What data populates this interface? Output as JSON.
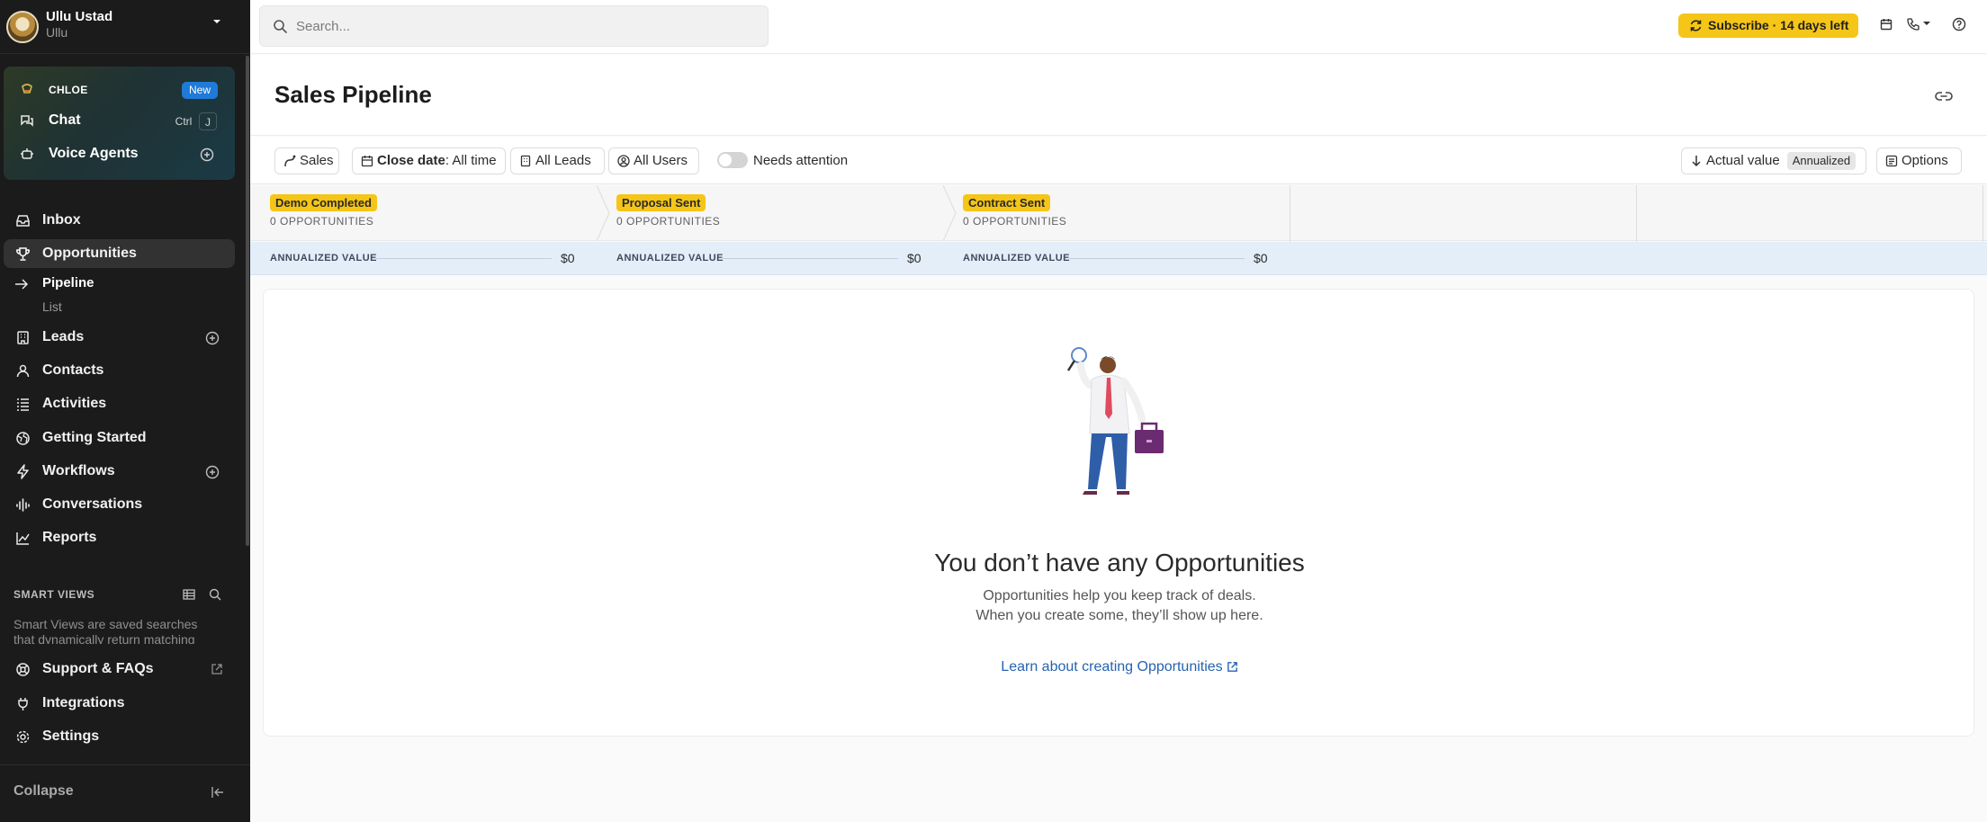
{
  "account": {
    "name": "Ullu Ustad",
    "org": "Ullu"
  },
  "ai": {
    "chloe_label": "CHLOE",
    "chloe_badge": "New",
    "chat_label": "Chat",
    "chat_kbd_ctrl": "Ctrl",
    "chat_kbd_key": "J",
    "voice_label": "Voice Agents"
  },
  "nav": {
    "inbox": "Inbox",
    "opportunities": "Opportunities",
    "pipeline": "Pipeline",
    "list": "List",
    "leads": "Leads",
    "contacts": "Contacts",
    "activities": "Activities",
    "getting_started": "Getting Started",
    "workflows": "Workflows",
    "conversations": "Conversations",
    "reports": "Reports",
    "smart_views_title": "SMART VIEWS",
    "smart_views_text": "Smart Views are saved searches that dynamically return matching",
    "support": "Support & FAQs",
    "integrations": "Integrations",
    "settings": "Settings",
    "collapse": "Collapse"
  },
  "topbar": {
    "search_placeholder": "Search...",
    "subscribe": "Subscribe · 14 days left"
  },
  "page": {
    "title": "Sales Pipeline"
  },
  "filters": {
    "pipeline": "Sales",
    "close_date_label": "Close date",
    "close_date_value": ": All time",
    "leads": "All Leads",
    "users": "All Users",
    "needs_attention": "Needs attention",
    "sort_label": "Actual value",
    "sort_tag": "Annualized",
    "options": "Options"
  },
  "stages": [
    {
      "name": "Demo Completed",
      "count": "0 OPPORTUNITIES",
      "value_label": "ANNUALIZED VALUE",
      "value": "$0"
    },
    {
      "name": "Proposal Sent",
      "count": "0 OPPORTUNITIES",
      "value_label": "ANNUALIZED VALUE",
      "value": "$0"
    },
    {
      "name": "Contract Sent",
      "count": "0 OPPORTUNITIES",
      "value_label": "ANNUALIZED VALUE",
      "value": "$0"
    }
  ],
  "empty": {
    "title": "You don’t have any Opportunities",
    "line1": "Opportunities help you keep track of deals.",
    "line2": "When you create some, they’ll show up here.",
    "link": "Learn about creating Opportunities"
  },
  "colors": {
    "sidebar": "#1b1b1b",
    "accent_yellow": "#f5c518",
    "link_blue": "#2563b0",
    "value_row": "#e3eef9"
  }
}
